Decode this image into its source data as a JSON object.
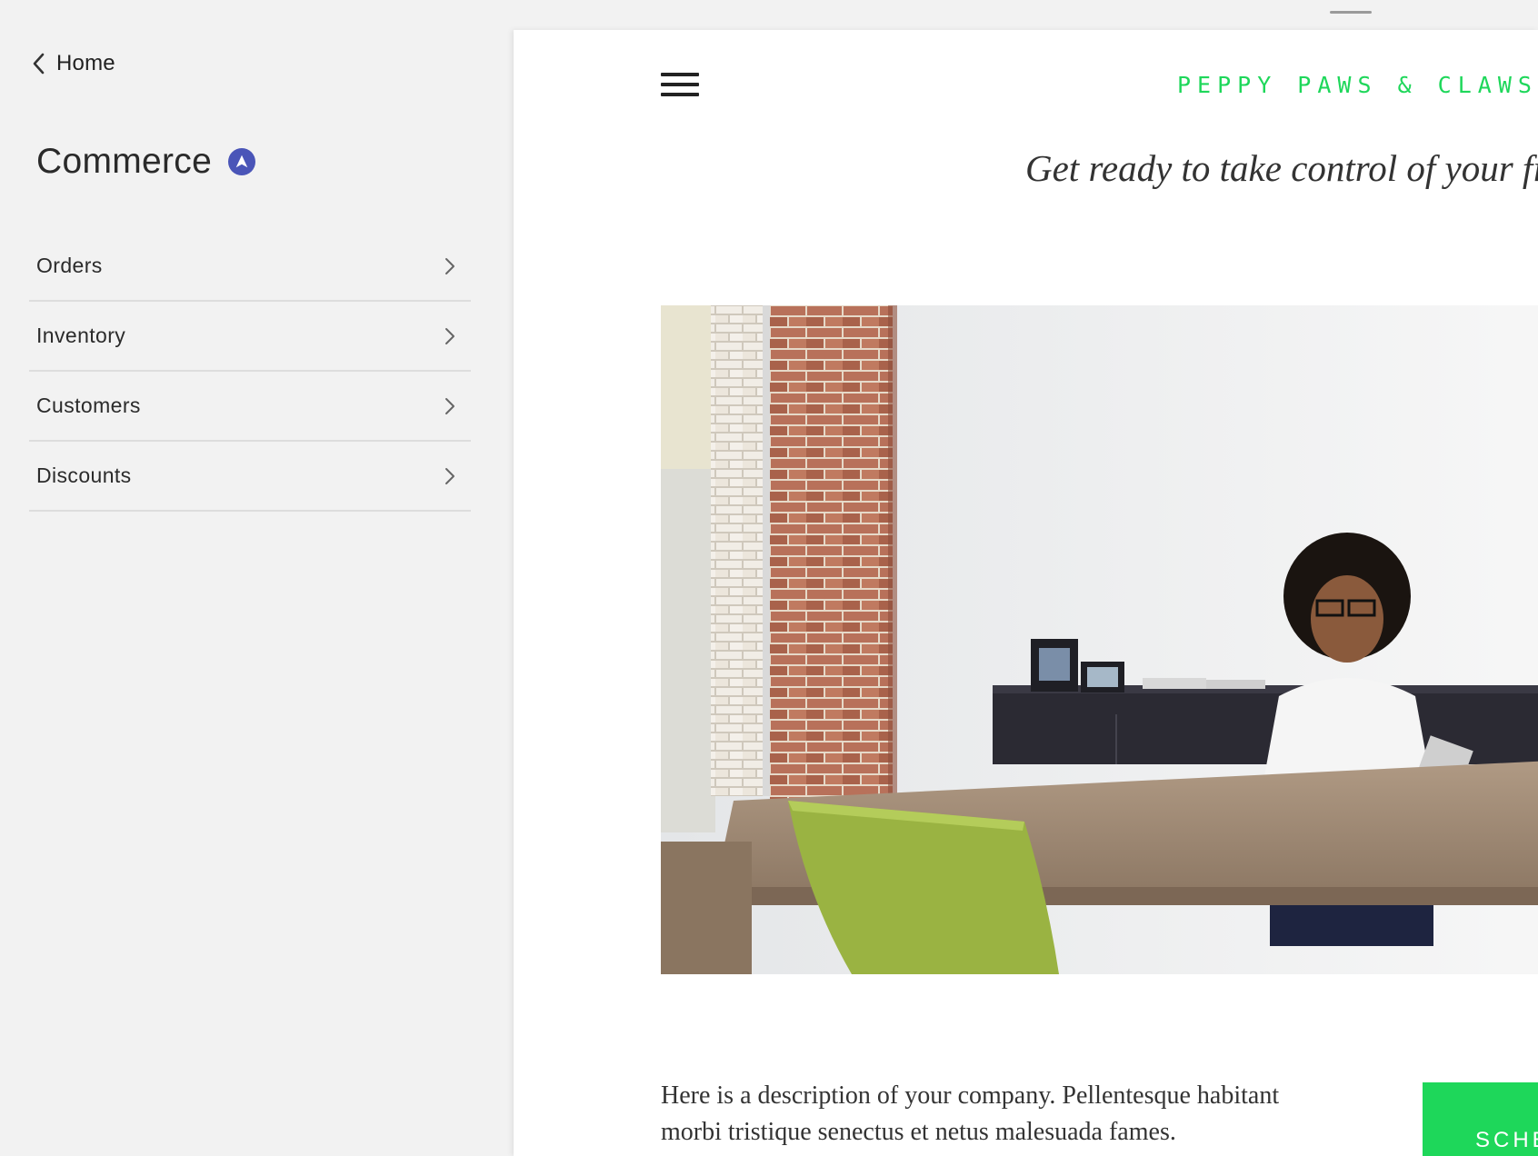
{
  "sidebar": {
    "back_label": "Home",
    "section_title": "Commerce",
    "items": [
      {
        "label": "Orders"
      },
      {
        "label": "Inventory"
      },
      {
        "label": "Customers"
      },
      {
        "label": "Discounts"
      }
    ]
  },
  "preview": {
    "brand": "PEPPY PAWS & CLAWS",
    "tagline": "Get ready to take control of your fi",
    "description": "Here is a description of your company. Pellentesque habitant morbi tristique senectus et netus malesuada fames.",
    "cta_label": "SCHE"
  },
  "colors": {
    "brand_green": "#1ed75a",
    "badge_blue": "#4a55b8",
    "sidebar_bg": "#f2f2f2"
  },
  "icons": {
    "back": "chevron-left-icon",
    "badge": "navigation-arrow-icon",
    "row": "chevron-right-icon",
    "menu": "hamburger-icon"
  }
}
